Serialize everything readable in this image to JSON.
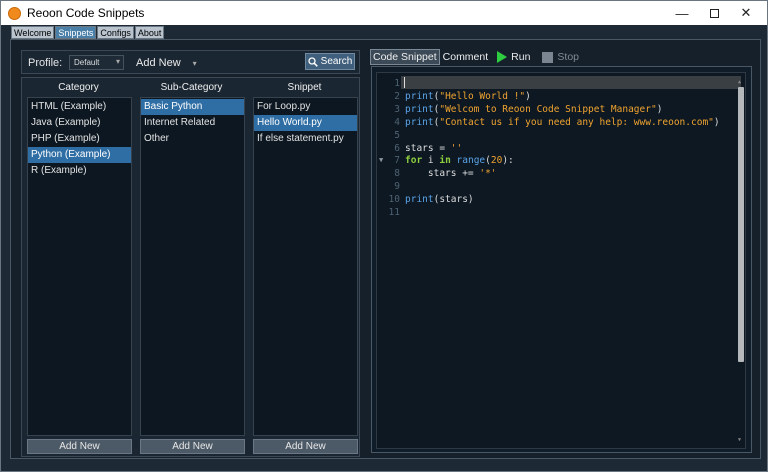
{
  "window": {
    "title": "Reoon Code Snippets"
  },
  "top_tabs": [
    {
      "label": "Welcome",
      "active": false
    },
    {
      "label": "Snippets",
      "active": true
    },
    {
      "label": "Configs",
      "active": false
    },
    {
      "label": "About",
      "active": false
    }
  ],
  "profile": {
    "label": "Profile:",
    "selected": "Default",
    "add_new": "Add New",
    "search_label": "Search"
  },
  "columns": {
    "category": {
      "header": "Category",
      "items": [
        "HTML (Example)",
        "Java (Example)",
        "PHP (Example)",
        "Python (Example)",
        "R (Example)"
      ],
      "selected_index": 3,
      "button": "Add New"
    },
    "subcategory": {
      "header": "Sub-Category",
      "items": [
        "Basic Python",
        "Internet Related",
        "Other"
      ],
      "selected_index": 0,
      "button": "Add New"
    },
    "snippet": {
      "header": "Snippet",
      "items": [
        "For Loop.py",
        "Hello World.py",
        "If else statement.py"
      ],
      "selected_index": 1,
      "button": "Add New"
    }
  },
  "editor_tabs": {
    "code_snippet": "Code Snippet",
    "comment": "Comment",
    "run": "Run",
    "stop": "Stop"
  },
  "code": {
    "line_numbers": [
      "1",
      "2",
      "3",
      "4",
      "5",
      "6",
      "7",
      "8",
      "9",
      "10",
      "11"
    ],
    "lines": [
      [],
      [
        {
          "t": "print",
          "c": "fn"
        },
        {
          "t": "(",
          "c": "pl"
        },
        {
          "t": "\"Hello World !\"",
          "c": "str"
        },
        {
          "t": ")",
          "c": "pl"
        }
      ],
      [
        {
          "t": "print",
          "c": "fn"
        },
        {
          "t": "(",
          "c": "pl"
        },
        {
          "t": "\"Welcom to Reoon Code Snippet Manager\"",
          "c": "str"
        },
        {
          "t": ")",
          "c": "pl"
        }
      ],
      [
        {
          "t": "print",
          "c": "fn"
        },
        {
          "t": "(",
          "c": "pl"
        },
        {
          "t": "\"Contact us if you need any help: www.reoon.com\"",
          "c": "str"
        },
        {
          "t": ")",
          "c": "pl"
        }
      ],
      [],
      [
        {
          "t": "stars = ",
          "c": "pl"
        },
        {
          "t": "''",
          "c": "str"
        }
      ],
      [
        {
          "t": "for",
          "c": "kw"
        },
        {
          "t": " i ",
          "c": "pl"
        },
        {
          "t": "in",
          "c": "kw"
        },
        {
          "t": " ",
          "c": "pl"
        },
        {
          "t": "range",
          "c": "fn"
        },
        {
          "t": "(",
          "c": "pl"
        },
        {
          "t": "20",
          "c": "num"
        },
        {
          "t": "):",
          "c": "pl"
        }
      ],
      [
        {
          "t": "    stars += ",
          "c": "pl"
        },
        {
          "t": "'*'",
          "c": "str"
        }
      ],
      [],
      [
        {
          "t": "print",
          "c": "fn"
        },
        {
          "t": "(stars)",
          "c": "pl"
        }
      ],
      []
    ]
  },
  "colors": {
    "accent": "#2f6ea4",
    "run_green": "#2ecc40",
    "string": "#f0a330",
    "function": "#5aa3e8",
    "keyword": "#8ccf3e"
  },
  "icons": {
    "app": "app-logo-icon",
    "search": "search-icon",
    "run": "play-icon",
    "stop": "stop-icon"
  }
}
